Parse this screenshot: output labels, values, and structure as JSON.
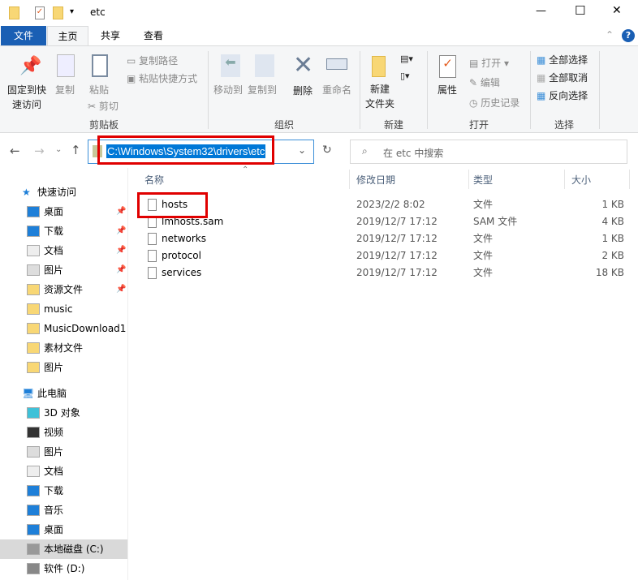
{
  "window": {
    "title": "etc",
    "minimize": "—",
    "maximize": "☐",
    "close": "✕"
  },
  "tabs": {
    "file": "文件",
    "home": "主页",
    "share": "共享",
    "view": "查看"
  },
  "ribbon": {
    "pin": "固定到快\n速访问",
    "pin1": "固定到快",
    "pin2": "速访问",
    "copy": "复制",
    "paste": "粘贴",
    "copy_path": "复制路径",
    "paste_shortcut": "粘贴快捷方式",
    "cut": "剪切",
    "clipboard": "剪贴板",
    "move_to": "移动到",
    "copy_to": "复制到",
    "delete": "删除",
    "rename": "重命名",
    "organize": "组织",
    "new_folder1": "新建",
    "new_folder2": "文件夹",
    "new_group": "新建",
    "properties": "属性",
    "open": "打开",
    "edit": "编辑",
    "history": "历史记录",
    "open_group": "打开",
    "select_all": "全部选择",
    "select_none": "全部取消",
    "invert": "反向选择",
    "select_group": "选择"
  },
  "address": {
    "path": "C:\\Windows\\System32\\drivers\\etc",
    "search_placeholder": "在 etc 中搜索"
  },
  "sidebar": {
    "quick": "快速访问",
    "quick_items": [
      {
        "label": "桌面",
        "pinned": true
      },
      {
        "label": "下载",
        "pinned": true
      },
      {
        "label": "文档",
        "pinned": true
      },
      {
        "label": "图片",
        "pinned": true
      },
      {
        "label": "资源文件",
        "pinned": true
      },
      {
        "label": "music"
      },
      {
        "label": "MusicDownload1"
      },
      {
        "label": "素材文件"
      },
      {
        "label": "图片"
      }
    ],
    "pc": "此电脑",
    "pc_items": [
      {
        "label": "3D 对象"
      },
      {
        "label": "视频"
      },
      {
        "label": "图片"
      },
      {
        "label": "文档"
      },
      {
        "label": "下载"
      },
      {
        "label": "音乐"
      },
      {
        "label": "桌面"
      },
      {
        "label": "本地磁盘 (C:)"
      },
      {
        "label": "软件 (D:)"
      }
    ]
  },
  "columns": {
    "name": "名称",
    "date": "修改日期",
    "type": "类型",
    "size": "大小"
  },
  "files": [
    {
      "name": "hosts",
      "date": "2023/2/2 8:02",
      "type": "文件",
      "size": "1 KB"
    },
    {
      "name": "lmhosts.sam",
      "date": "2019/12/7 17:12",
      "type": "SAM 文件",
      "size": "4 KB"
    },
    {
      "name": "networks",
      "date": "2019/12/7 17:12",
      "type": "文件",
      "size": "1 KB"
    },
    {
      "name": "protocol",
      "date": "2019/12/7 17:12",
      "type": "文件",
      "size": "2 KB"
    },
    {
      "name": "services",
      "date": "2019/12/7 17:12",
      "type": "文件",
      "size": "18 KB"
    }
  ]
}
